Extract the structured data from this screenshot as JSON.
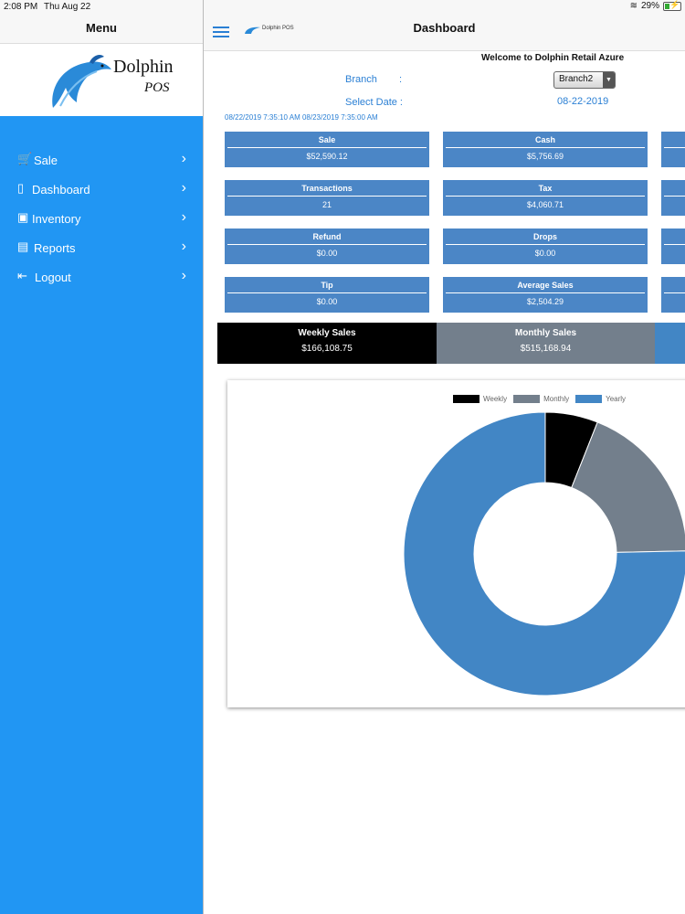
{
  "status": {
    "time": "2:08 PM",
    "date": "Thu Aug 22",
    "battery": "29%"
  },
  "sidebar": {
    "title": "Menu",
    "logo": {
      "line1": "Dolphin",
      "line2": "POS"
    },
    "items": [
      {
        "label": "Sale",
        "icon": "cart-icon"
      },
      {
        "label": "Dashboard",
        "icon": "clipboard-icon"
      },
      {
        "label": "Inventory",
        "icon": "box-icon"
      },
      {
        "label": "Reports",
        "icon": "report-icon"
      },
      {
        "label": "Logout",
        "icon": "logout-icon"
      }
    ]
  },
  "header": {
    "title": "Dashboard",
    "mini_logo": "Dolphin POS"
  },
  "welcome": "Welcome to  Dolphin Retail Azure",
  "filters": {
    "branch_label": "Branch",
    "colon": ":",
    "branch_value": "Branch2",
    "date_label": "Select Date :",
    "date_value": "08-22-2019",
    "range": "08/22/2019 7:35:10 AM 08/23/2019 7:35:00 AM"
  },
  "tiles": [
    {
      "label": "Sale",
      "value": "$52,590.12"
    },
    {
      "label": "Cash",
      "value": "$5,756.69"
    },
    {
      "label": "Transactions",
      "value": "21"
    },
    {
      "label": "Tax",
      "value": "$4,060.71"
    },
    {
      "label": "Refund",
      "value": "$0.00"
    },
    {
      "label": "Drops",
      "value": "$0.00"
    },
    {
      "label": "Tip",
      "value": "$0.00"
    },
    {
      "label": "Average Sales",
      "value": "$2,504.29"
    }
  ],
  "summary": [
    {
      "label": "Weekly Sales",
      "value": "$166,108.75"
    },
    {
      "label": "Monthly Sales",
      "value": "$515,168.94"
    }
  ],
  "colors": {
    "accent": "#2196f3",
    "tile": "#4b86c6",
    "weekly": "#000000",
    "monthly": "#737f8c",
    "yearly": "#4286c5"
  },
  "chart_data": {
    "type": "pie",
    "legend": "top",
    "series": [
      {
        "name": "Weekly",
        "value": 166108.75
      },
      {
        "name": "Monthly",
        "value": 515168.94
      },
      {
        "name": "Yearly",
        "value": 2080000
      }
    ]
  }
}
